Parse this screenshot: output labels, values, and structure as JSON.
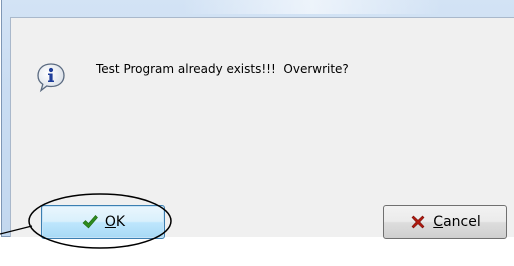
{
  "dialog": {
    "message": "Test Program already exists!!!  Overwrite?",
    "icon": "information-icon"
  },
  "buttons": {
    "ok": {
      "accel": "O",
      "rest": "K",
      "icon": "checkmark-icon",
      "icon_color": "#2e8b1e"
    },
    "cancel": {
      "accel": "C",
      "rest": "ancel",
      "icon": "x-icon",
      "icon_color": "#b11a10"
    }
  },
  "annotation": {
    "highlight": "ok-button",
    "stroke_color": "#000000"
  }
}
